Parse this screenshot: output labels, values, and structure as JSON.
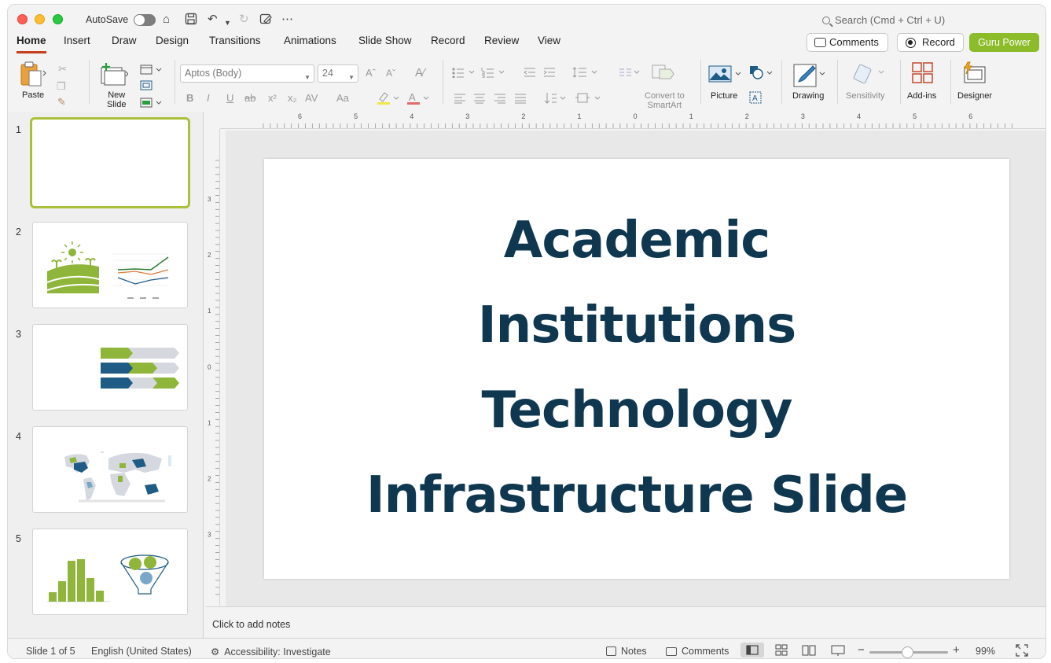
{
  "window": {
    "autosave_label": "AutoSave",
    "search_placeholder": "Search (Cmd + Ctrl + U)"
  },
  "tabs": [
    {
      "label": "Home",
      "active": true
    },
    {
      "label": "Insert"
    },
    {
      "label": "Draw"
    },
    {
      "label": "Design"
    },
    {
      "label": "Transitions"
    },
    {
      "label": "Animations"
    },
    {
      "label": "Slide Show"
    },
    {
      "label": "Record"
    },
    {
      "label": "Review"
    },
    {
      "label": "View"
    }
  ],
  "header_buttons": {
    "comments": "Comments",
    "record": "Record",
    "guru": "Guru Power",
    "guru_color": "#8cbc2a"
  },
  "ribbon": {
    "paste": "Paste",
    "new_slide_line1": "New",
    "new_slide_line2": "Slide",
    "font_name": "Aptos (Body)",
    "font_size": "24",
    "convert_line1": "Convert to",
    "convert_line2": "SmartArt",
    "picture": "Picture",
    "drawing": "Drawing",
    "sensitivity": "Sensitivity",
    "addins": "Add-ins",
    "designer": "Designer",
    "format_glyphs": [
      "B",
      "I",
      "U",
      "ab",
      "x²",
      "x₂",
      "AV",
      "Aa"
    ]
  },
  "thumbnails": [
    {
      "num": "1",
      "selected": true
    },
    {
      "num": "2"
    },
    {
      "num": "3"
    },
    {
      "num": "4"
    },
    {
      "num": "5"
    }
  ],
  "slide": {
    "title_lines": [
      "Academic",
      "Institutions",
      "Technology",
      "Infrastructure Slide"
    ],
    "title_color": "#0f3750"
  },
  "notes_placeholder": "Click to add notes",
  "status": {
    "slide_count": "Slide 1 of 5",
    "language": "English (United States)",
    "accessibility": "Accessibility: Investigate",
    "notes": "Notes",
    "comments": "Comments",
    "zoom": "99%"
  },
  "ruler": {
    "h_labels": [
      "6",
      "5",
      "4",
      "3",
      "2",
      "1",
      "0",
      "1",
      "2",
      "3",
      "4",
      "5",
      "6"
    ],
    "v_labels": [
      "3",
      "2",
      "1",
      "0",
      "1",
      "2",
      "3"
    ]
  },
  "colors": {
    "accent_green": "#a9c13a",
    "chart_green": "#8fb63a",
    "chart_blue": "#1f5c85",
    "tab_underline": "#c43e1c"
  }
}
